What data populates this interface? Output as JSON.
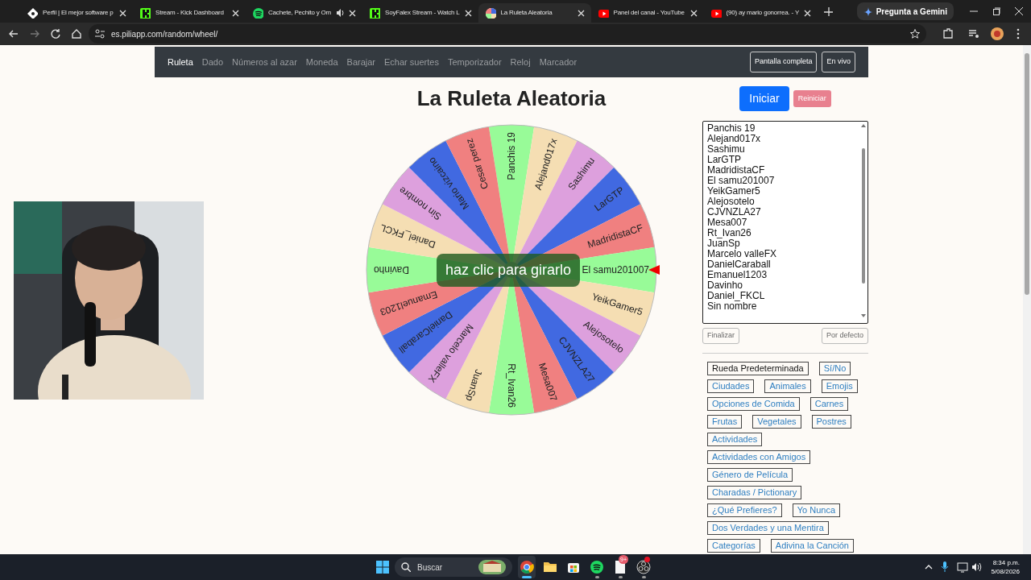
{
  "browser": {
    "tabs": [
      {
        "kind": "page",
        "title": "Perfil | El mejor software p",
        "audio": false,
        "selected": false
      },
      {
        "kind": "kick",
        "title": "Stream - Kick Dashboard",
        "audio": false,
        "selected": false
      },
      {
        "kind": "spotify",
        "title": "Cachete, Pechito y Om",
        "audio": true,
        "selected": false
      },
      {
        "kind": "kick",
        "title": "SoyFalex Stream - Watch L",
        "audio": false,
        "selected": false
      },
      {
        "kind": "wheel",
        "title": "La Ruleta Aleatoria",
        "audio": false,
        "selected": true
      },
      {
        "kind": "youtube",
        "title": "Panel del canal - YouTube",
        "audio": false,
        "selected": false
      },
      {
        "kind": "youtube",
        "title": "(90) ay mario gonorrea. - Y",
        "audio": false,
        "selected": false
      }
    ],
    "gemini_button": "Pregunta a Gemini",
    "url": "es.piliapp.com/random/wheel/"
  },
  "nav": {
    "items": [
      {
        "label": "Ruleta",
        "selected": true
      },
      {
        "label": "Dado",
        "selected": false
      },
      {
        "label": "Números al azar",
        "selected": false
      },
      {
        "label": "Moneda",
        "selected": false
      },
      {
        "label": "Barajar",
        "selected": false
      },
      {
        "label": "Echar suertes",
        "selected": false
      },
      {
        "label": "Temporizador",
        "selected": false
      },
      {
        "label": "Reloj",
        "selected": false
      },
      {
        "label": "Marcador",
        "selected": false
      }
    ],
    "buttons": [
      "Pantalla completa",
      "En vivo"
    ]
  },
  "title": "La Ruleta Aleatoria",
  "start_button": "Iniciar",
  "reset_button": "Reiniciar",
  "wheel": {
    "center_label": "haz clic para girarlo",
    "segments": [
      {
        "label": "Panchis 19",
        "color": "#98fb98"
      },
      {
        "label": "Alejand017x",
        "color": "#f5deb3"
      },
      {
        "label": "Sashimu",
        "color": "#dda0dd"
      },
      {
        "label": "LarGTP",
        "color": "#4169e1"
      },
      {
        "label": "MadridistaCF",
        "color": "#f08080"
      },
      {
        "label": "El samu201007",
        "color": "#98fb98"
      },
      {
        "label": "YeikGamer5",
        "color": "#f5deb3"
      },
      {
        "label": "Alejosotelo",
        "color": "#dda0dd"
      },
      {
        "label": "CJVNZLA27",
        "color": "#4169e1"
      },
      {
        "label": "Mesa007",
        "color": "#f08080"
      },
      {
        "label": "Rt_Ivan26",
        "color": "#98fb98"
      },
      {
        "label": "JuanSp",
        "color": "#f5deb3"
      },
      {
        "label": "Marcelo valleFX",
        "color": "#dda0dd"
      },
      {
        "label": "DanielCaraball",
        "color": "#4169e1"
      },
      {
        "label": "Emanuel1203",
        "color": "#f08080"
      },
      {
        "label": "Davinho",
        "color": "#98fb98"
      },
      {
        "label": "Daniel_FKCL",
        "color": "#f5deb3"
      },
      {
        "label": "Sin nombre",
        "color": "#dda0dd"
      },
      {
        "label": "Mario vizcaino",
        "color": "#4169e1"
      },
      {
        "label": "Cesar perez",
        "color": "#f08080"
      }
    ]
  },
  "names_field": {
    "lines": [
      "Panchis 19",
      "Alejand017x",
      "Sashimu",
      "LarGTP",
      "MadridistaCF",
      "El samu201007",
      "YeikGamer5",
      "Alejosotelo",
      "CJVNZLA27",
      "Mesa007",
      "Rt_Ivan26",
      "JuanSp",
      "Marcelo valleFX",
      "DanielCaraball",
      "Emanuel1203",
      "Davinho",
      "Daniel_FKCL",
      "Sin nombre"
    ]
  },
  "finalize_button": "Finalizar",
  "default_button": "Por defecto",
  "presets": [
    {
      "label": "Rueda Predeterminada",
      "selected": true
    },
    {
      "label": "Sí/No",
      "selected": false
    },
    {
      "label": "Ciudades",
      "selected": false
    },
    {
      "label": "Animales",
      "selected": false
    },
    {
      "label": "Emojis",
      "selected": false
    },
    {
      "label": "Opciones de Comida",
      "selected": false
    },
    {
      "label": "Carnes",
      "selected": false
    },
    {
      "label": "Frutas",
      "selected": false
    },
    {
      "label": "Vegetales",
      "selected": false
    },
    {
      "label": "Postres",
      "selected": false
    },
    {
      "label": "Actividades",
      "selected": false
    },
    {
      "label": "Actividades con Amigos",
      "selected": false
    },
    {
      "label": "Género de Película",
      "selected": false
    },
    {
      "label": "Charadas / Pictionary",
      "selected": false
    },
    {
      "label": "¿Qué Prefieres?",
      "selected": false
    },
    {
      "label": "Yo Nunca",
      "selected": false
    },
    {
      "label": "Dos Verdades y una Mentira",
      "selected": false
    },
    {
      "label": "Categorías",
      "selected": false
    },
    {
      "label": "Adivina la Canción",
      "selected": false
    }
  ],
  "taskbar": {
    "search": "Buscar",
    "apps": [
      {
        "kind": "chrome",
        "running": true,
        "active": true
      },
      {
        "kind": "folder",
        "running": false,
        "active": false
      },
      {
        "kind": "store",
        "running": false,
        "active": false
      },
      {
        "kind": "spotify",
        "running": true,
        "active": false
      },
      {
        "kind": "file",
        "running": true,
        "active": false,
        "badge": "9+"
      },
      {
        "kind": "obs",
        "running": true,
        "active": false,
        "dot": true
      }
    ],
    "time": "8:34 p.m.",
    "date": "5/08/2026"
  }
}
